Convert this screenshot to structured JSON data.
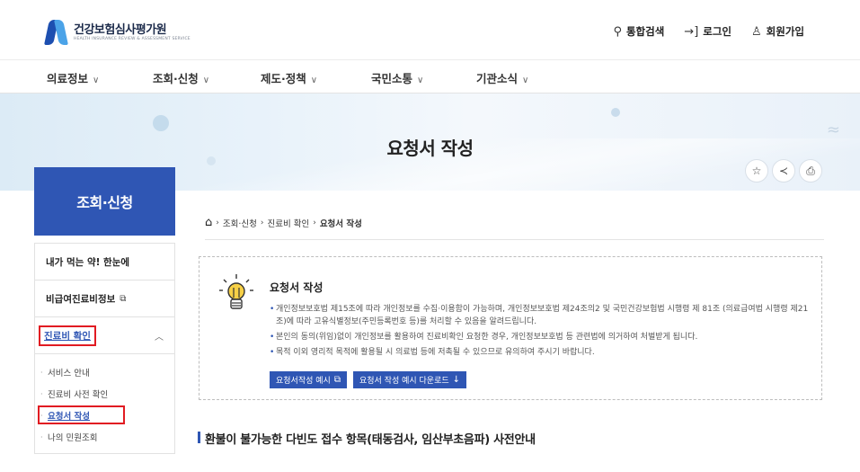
{
  "header": {
    "logo_ko": "건강보험심사평가원",
    "logo_en": "HEALTH INSURANCE REVIEW & ASSESSMENT SERVICE",
    "util": [
      {
        "icon": "search-icon",
        "glyph": "🔍︎",
        "label": "통합검색"
      },
      {
        "icon": "login-icon",
        "glyph": "→]",
        "label": "로그인"
      },
      {
        "icon": "user-plus-icon",
        "glyph": "♙⁺",
        "label": "회원가입"
      }
    ]
  },
  "gnb": [
    {
      "label": "의료정보"
    },
    {
      "label": "조회·신청"
    },
    {
      "label": "제도·정책"
    },
    {
      "label": "국민소통"
    },
    {
      "label": "기관소식"
    }
  ],
  "banner": {
    "title": "요청서 작성"
  },
  "tools": [
    {
      "icon": "star-icon",
      "glyph": "☆"
    },
    {
      "icon": "share-icon",
      "glyph": "≺"
    },
    {
      "icon": "print-icon",
      "glyph": "⎙"
    }
  ],
  "sidebar": {
    "title": "조회·신청",
    "items": [
      {
        "label": "내가 먹는 약! 한눈에"
      },
      {
        "label": "비급여진료비정보",
        "ext": "⧉"
      },
      {
        "label": "진료비 확인",
        "caret": "︿"
      }
    ],
    "sub": [
      {
        "label": "서비스 안내"
      },
      {
        "label": "진료비 사전 확인"
      },
      {
        "label": "요청서 작성"
      },
      {
        "label": "나의 민원조회"
      }
    ]
  },
  "breadcrumb": {
    "items": [
      "조회·신청",
      "진료비 확인",
      "요청서 작성"
    ]
  },
  "notice": {
    "title": "요청서 작성",
    "bullets": [
      "개인정보보호법 제15조에 따라 개인정보를 수집·이용함이 가능하며, 개인정보보호법 제24조의2 및 국민건강보험법 시행령 제 81조 (의료급여법 시행령 제21조)에 따라 고유식별정보(주민등록번호 등)를 처리할 수 있음을 알려드립니다.",
      "본인의 동의(위임)없이 개인정보를 활용하여 진료비확인 요청한 경우, 개인정보보호법 등 관련법에 의거하여 처벌받게 됩니다.",
      "목적 이외 영리적 목적에 활용될 시 의료법 등에 저촉될 수 있으므로 유의하여 주시기 바랍니다."
    ],
    "buttons": [
      {
        "label": "요청서작성 예시",
        "glyph": "⧉"
      },
      {
        "label": "요청서 작성 예시 다운로드",
        "glyph": "↓"
      }
    ]
  },
  "section": {
    "title": "환불이 불가능한 다빈도 접수 항목(태동검사, 임산부초음파) 사전안내"
  },
  "colors": {
    "primary": "#2f56b4",
    "highlight": "#e11b22"
  }
}
